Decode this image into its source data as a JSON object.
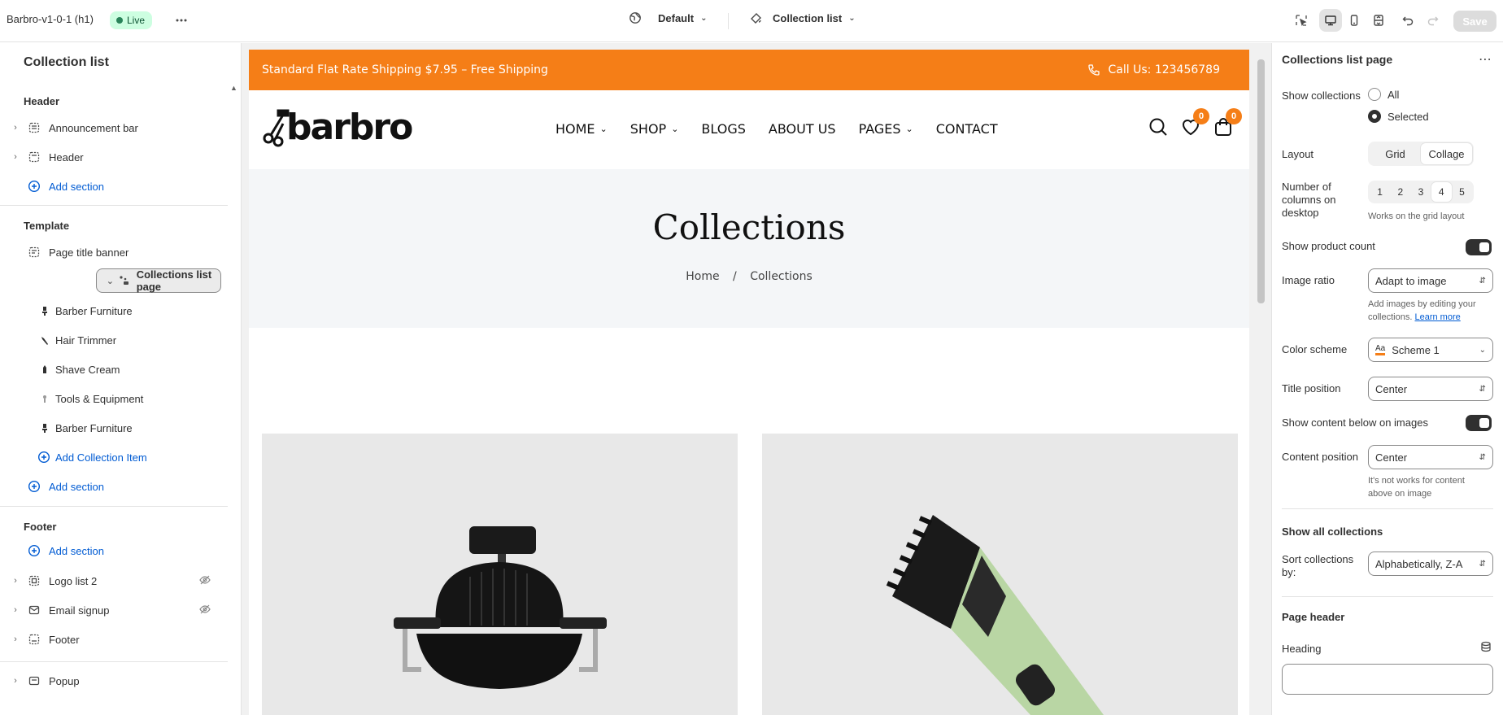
{
  "topbar": {
    "theme_name": "Barbro-v1-0-1 (h1)",
    "status": "Live",
    "market": "Default",
    "page_selector": "Collection list",
    "save_label": "Save"
  },
  "sidebar": {
    "title": "Collection list",
    "groups": [
      {
        "label": "Header"
      },
      {
        "label": "Template"
      },
      {
        "label": "Footer"
      }
    ],
    "header_items": [
      {
        "label": "Announcement bar"
      },
      {
        "label": "Header"
      }
    ],
    "template_items": [
      {
        "label": "Page title banner"
      },
      {
        "label": "Collections list page"
      }
    ],
    "collection_items": [
      {
        "label": "Barber Furniture"
      },
      {
        "label": "Hair Trimmer"
      },
      {
        "label": "Shave Cream"
      },
      {
        "label": "Tools & Equipment"
      },
      {
        "label": "Barber Furniture"
      }
    ],
    "add_collection_item": "Add Collection Item",
    "add_section": "Add section",
    "footer_items": [
      {
        "label": "Logo list 2"
      },
      {
        "label": "Email signup"
      },
      {
        "label": "Footer"
      }
    ],
    "popup": "Popup"
  },
  "preview": {
    "announcement": "Standard Flat Rate Shipping $7.95 – Free Shipping",
    "call": "Call Us: 123456789",
    "logo_text": "barbro",
    "nav": [
      "HOME",
      "SHOP",
      "BLOGS",
      "ABOUT US",
      "PAGES",
      "CONTACT"
    ],
    "wishlist_count": "0",
    "cart_count": "0",
    "page_title": "Collections",
    "breadcrumb_home": "Home",
    "breadcrumb_sep": "/",
    "breadcrumb_current": "Collections",
    "accent_color": "#f57e17"
  },
  "settings": {
    "title": "Collections list page",
    "show_collections_label": "Show collections",
    "show_all": "All",
    "show_selected": "Selected",
    "layout_label": "Layout",
    "layout_grid": "Grid",
    "layout_collage": "Collage",
    "columns_label": "Number of columns on desktop",
    "columns": [
      "1",
      "2",
      "3",
      "4",
      "5"
    ],
    "columns_selected": "4",
    "columns_help": "Works on the grid layout",
    "product_count_label": "Show product count",
    "image_ratio_label": "Image ratio",
    "image_ratio_value": "Adapt to image",
    "image_ratio_help": "Add images by editing your collections.",
    "learn_more": "Learn more",
    "color_scheme_label": "Color scheme",
    "color_scheme_value": "Scheme 1",
    "title_position_label": "Title position",
    "title_position_value": "Center",
    "content_below_label": "Show content below on images",
    "content_position_label": "Content position",
    "content_position_value": "Center",
    "content_position_help": "It's not works for content above on image",
    "show_all_collections": "Show all collections",
    "sort_label": "Sort collections by:",
    "sort_value": "Alphabetically, Z-A",
    "page_header": "Page header",
    "heading_label": "Heading"
  }
}
